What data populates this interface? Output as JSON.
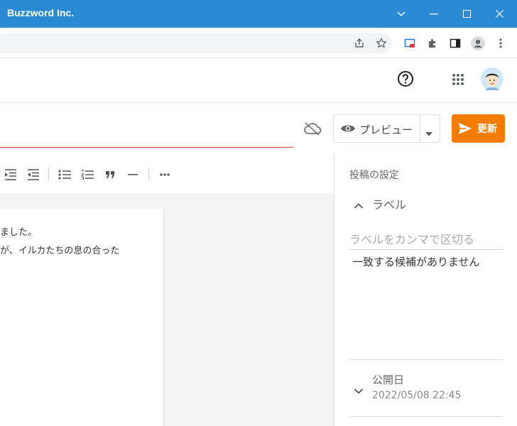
{
  "window": {
    "title": "Buzzword Inc."
  },
  "header": {
    "help_icon": "help-icon",
    "apps_icon": "apps-grid-icon"
  },
  "editor": {
    "preview_label": "プレビュー",
    "update_label": "更新",
    "body_lines": [
      "ました。",
      "が、イルカたちの息の合った"
    ]
  },
  "sidebar": {
    "heading": "投稿の設定",
    "labels": {
      "title": "ラベル",
      "placeholder": "ラベルをカンマで区切る",
      "no_match": "一致する候補がありません"
    },
    "publish": {
      "title": "公開日",
      "datetime": "2022/05/08 22:45"
    }
  },
  "colors": {
    "titlebar": "#2a8ad4",
    "accent": "#f57c00",
    "underline": "#e53935"
  }
}
